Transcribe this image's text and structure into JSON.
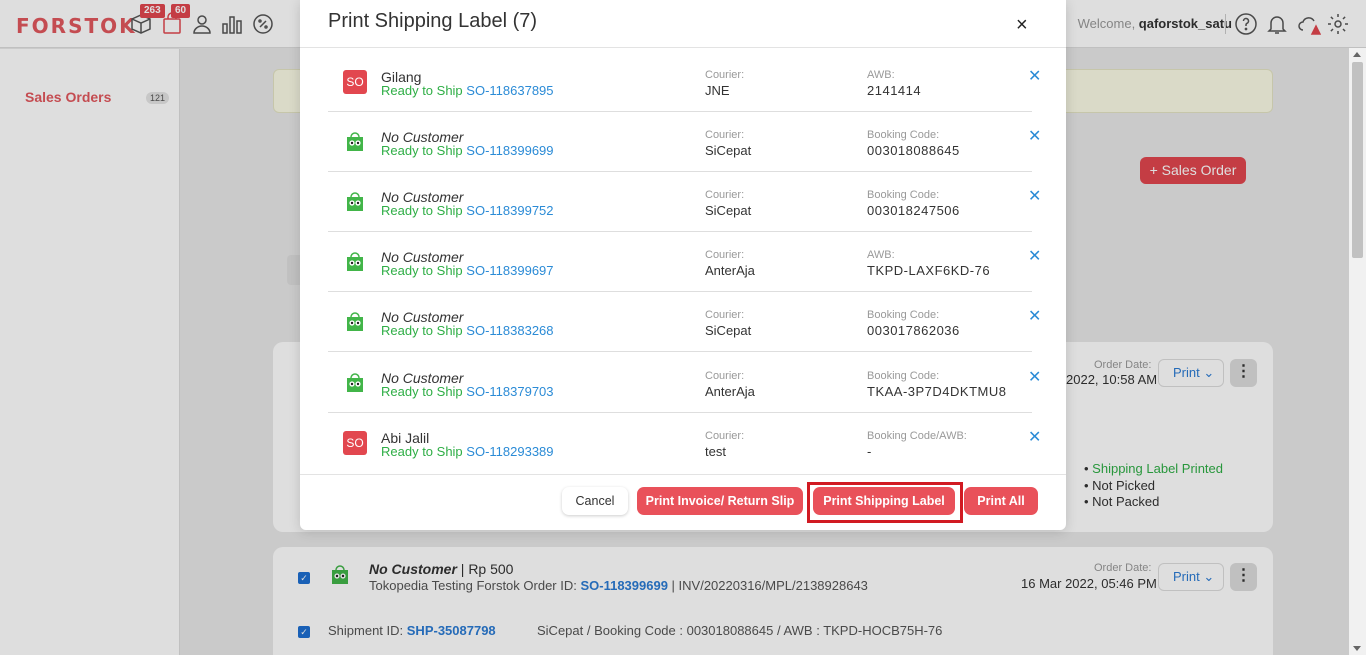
{
  "app": {
    "logo": "FORSTOK",
    "badges": {
      "packages": "263",
      "orders": "60"
    },
    "welcome_prefix": "Welcome, ",
    "username": "qaforstok_satu"
  },
  "sidebar": {
    "items": [
      {
        "label": "Sales Orders",
        "count": "121"
      }
    ]
  },
  "page": {
    "add_button": "+ Sales Order"
  },
  "background_orders": [
    {
      "order_date_label": "Order Date:",
      "order_date": "2022, 10:58 AM",
      "print_label": "Print",
      "status": [
        "Shipping Label Printed",
        "Not Picked",
        "Not Packed"
      ]
    },
    {
      "customer": "No Customer",
      "amount": " | Rp 500",
      "store_prefix": "Tokopedia Testing Forstok Order ID: ",
      "order_id": "SO-118399699",
      "invoice": " | INV/20220316/MPL/2138928643",
      "order_date_label": "Order Date:",
      "order_date": "16 Mar 2022, 05:46 PM",
      "print_label": "Print",
      "shipment_prefix": "Shipment ID: ",
      "shipment_id": "SHP-35087798",
      "shipment_info": "SiCepat / Booking Code : 003018088645 / AWB : TKPD-HOCB75H-76"
    }
  ],
  "modal": {
    "title": "Print Shipping Label (7)",
    "close": "×",
    "ready_label": "Ready to Ship",
    "courier_label": "Courier:",
    "rows": [
      {
        "icon": "SO",
        "customer": "Gilang",
        "italic": false,
        "so": "SO-118637895",
        "courier": "JNE",
        "code_label": "AWB:",
        "code": "2141414"
      },
      {
        "icon": "tokopedia",
        "customer": "No Customer",
        "italic": true,
        "so": "SO-118399699",
        "courier": "SiCepat",
        "code_label": "Booking Code:",
        "code": "003018088645"
      },
      {
        "icon": "tokopedia",
        "customer": "No Customer",
        "italic": true,
        "so": "SO-118399752",
        "courier": "SiCepat",
        "code_label": "Booking Code:",
        "code": "003018247506"
      },
      {
        "icon": "tokopedia",
        "customer": "No Customer",
        "italic": true,
        "so": "SO-118399697",
        "courier": "AnterAja",
        "code_label": "AWB:",
        "code": "TKPD-LAXF6KD-76"
      },
      {
        "icon": "tokopedia",
        "customer": "No Customer",
        "italic": true,
        "so": "SO-118383268",
        "courier": "SiCepat",
        "code_label": "Booking Code:",
        "code": "003017862036"
      },
      {
        "icon": "tokopedia",
        "customer": "No Customer",
        "italic": true,
        "so": "SO-118379703",
        "courier": "AnterAja",
        "code_label": "Booking Code:",
        "code": "TKAA-3P7D4DKTMU8"
      },
      {
        "icon": "SO",
        "customer": "Abi Jalil",
        "italic": false,
        "so": "SO-118293389",
        "courier": "test",
        "code_label": "Booking Code/AWB:",
        "code": "-"
      }
    ],
    "buttons": {
      "cancel": "Cancel",
      "print_invoice": "Print Invoice/ Return Slip",
      "print_label": "Print Shipping Label",
      "print_all": "Print All"
    }
  },
  "colors": {
    "brand": "#e2585e",
    "button_red": "#e9515a",
    "ready_green": "#2fae46",
    "link_blue": "#2b8bd6",
    "highlight": "#d11a22"
  }
}
